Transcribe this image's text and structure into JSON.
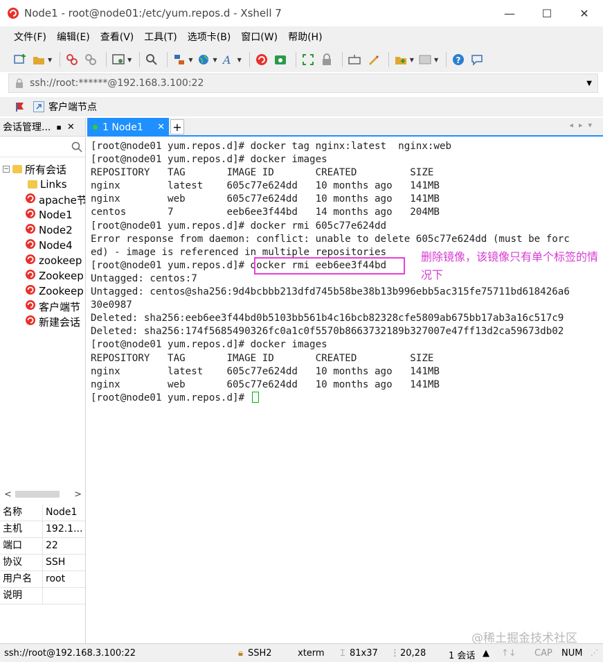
{
  "window": {
    "title": "Node1 - root@node01:/etc/yum.repos.d - Xshell 7",
    "minimize": "—",
    "maximize": "☐",
    "close": "✕"
  },
  "menu": [
    "文件(F)",
    "编辑(E)",
    "查看(V)",
    "工具(T)",
    "选项卡(B)",
    "窗口(W)",
    "帮助(H)"
  ],
  "address": {
    "value": "ssh://root:******@192.168.3.100:22"
  },
  "linkbar": {
    "label": "客户端节点"
  },
  "left_pane": {
    "title": "会话管理...",
    "pin": "▪",
    "close": "✕",
    "tree_root": "所有会话",
    "tree_items": [
      {
        "label": "Links",
        "icon": "folder-icon"
      },
      {
        "label": "apache节",
        "icon": "xshell-session-icon"
      },
      {
        "label": "Node1",
        "icon": "xshell-session-icon"
      },
      {
        "label": "Node2",
        "icon": "xshell-session-icon"
      },
      {
        "label": "Node4",
        "icon": "xshell-session-icon"
      },
      {
        "label": "zookeep",
        "icon": "xshell-session-icon"
      },
      {
        "label": "Zookeep",
        "icon": "xshell-session-icon"
      },
      {
        "label": "Zookeep",
        "icon": "xshell-session-icon"
      },
      {
        "label": "客户端节",
        "icon": "xshell-session-icon"
      },
      {
        "label": "新建会话",
        "icon": "xshell-session-icon"
      }
    ],
    "scroll_left": "<",
    "scroll_right": ">",
    "properties": [
      {
        "key": "名称",
        "value": "Node1"
      },
      {
        "key": "主机",
        "value": "192.1..."
      },
      {
        "key": "端口",
        "value": "22"
      },
      {
        "key": "协议",
        "value": "SSH"
      },
      {
        "key": "用户名",
        "value": "root"
      },
      {
        "key": "说明",
        "value": ""
      }
    ]
  },
  "tab": {
    "label": "1 Node1",
    "close": "✕",
    "add": "+"
  },
  "terminal": {
    "lines": [
      "[root@node01 yum.repos.d]# docker tag nginx:latest  nginx:web",
      "[root@node01 yum.repos.d]# docker images",
      "REPOSITORY   TAG       IMAGE ID       CREATED         SIZE",
      "nginx        latest    605c77e624dd   10 months ago   141MB",
      "nginx        web       605c77e624dd   10 months ago   141MB",
      "centos       7         eeb6ee3f44bd   14 months ago   204MB",
      "[root@node01 yum.repos.d]# docker rmi 605c77e624dd",
      "Error response from daemon: conflict: unable to delete 605c77e624dd (must be forc",
      "ed) - image is referenced in multiple repositories",
      "[root@node01 yum.repos.d]# docker rmi eeb6ee3f44bd",
      "Untagged: centos:7",
      "Untagged: centos@sha256:9d4bcbbb213dfd745b58be38b13b996ebb5ac315fe75711bd618426a6",
      "30e0987",
      "Deleted: sha256:eeb6ee3f44bd0b5103bb561b4c16bcb82328cfe5809ab675bb17ab3a16c517c9",
      "Deleted: sha256:174f5685490326fc0a1c0f5570b8663732189b327007e47ff13d2ca59673db02",
      "[root@node01 yum.repos.d]# docker images",
      "REPOSITORY   TAG       IMAGE ID       CREATED         SIZE",
      "nginx        latest    605c77e624dd   10 months ago   141MB",
      "nginx        web       605c77e624dd   10 months ago   141MB",
      "[root@node01 yum.repos.d]# "
    ],
    "annotation": "删除镜像，该镜像只有单个标签的情况下",
    "highlight_color": "#e83ed8",
    "cursor_color": "#00b000"
  },
  "watermark": "@稀土掘金技术社区",
  "status": {
    "connection": "ssh://root@192.168.3.100:22",
    "protocol": "SSH2",
    "terminal_type": "xterm",
    "size": "81x37",
    "cursor_pos": "20,28",
    "sessions": "1 会话",
    "cap": "CAP",
    "num": "NUM"
  },
  "colors": {
    "accent": "#1e90ff",
    "annotation": "#d63cd2"
  }
}
